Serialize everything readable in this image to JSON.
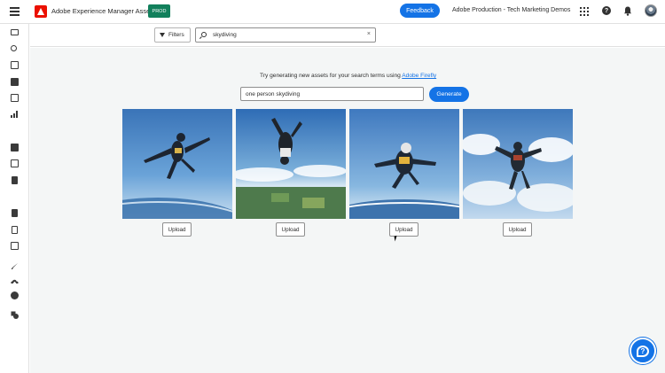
{
  "header": {
    "app_title": "Adobe Experience Manager Assets",
    "env_badge": "PROD",
    "feedback_label": "Feedback",
    "org_name": "Adobe Production - Tech Marketing Demos",
    "icons": [
      "menu-icon",
      "adobe-logo-icon",
      "app-switcher-icon",
      "help-icon",
      "notifications-icon",
      "avatar"
    ],
    "accent_color": "#1473e6",
    "brand_color": "#eb1000",
    "badge_color": "#12805c"
  },
  "rail": {
    "icons": [
      "rail-panel-icon",
      "search-icon",
      "list-icon",
      "assets-icon",
      "collections-icon",
      "insights-icon",
      "templates-icon",
      "grid-icon",
      "trash-icon",
      "document-icon",
      "report-icon",
      "task-list-icon",
      "brush-icon",
      "cloud-upload-icon",
      "settings-icon",
      "shapes-icon"
    ]
  },
  "search": {
    "filters_label": "Filters",
    "query": "skydiving",
    "clear_symbol": "×"
  },
  "generate": {
    "hint_prefix": "Try generating new assets for your search terms using ",
    "hint_link": "Adobe Firefly",
    "prompt_value": "one person skydiving",
    "generate_label": "Generate"
  },
  "results": [
    {
      "name": "generated-image-1",
      "upload_label": "Upload"
    },
    {
      "name": "generated-image-2",
      "upload_label": "Upload"
    },
    {
      "name": "generated-image-3",
      "upload_label": "Upload"
    },
    {
      "name": "generated-image-4",
      "upload_label": "Upload"
    }
  ],
  "help_fab_label": "?"
}
